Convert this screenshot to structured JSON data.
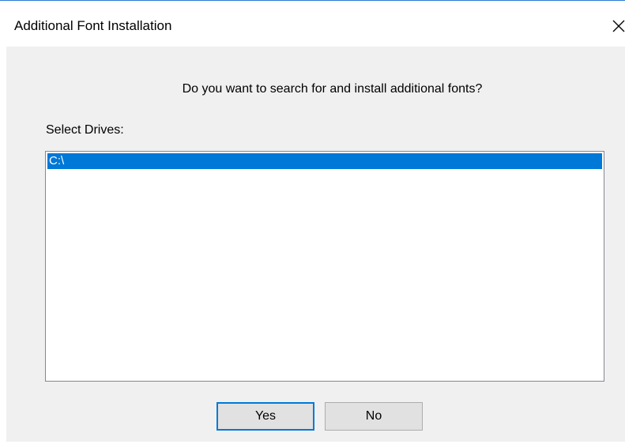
{
  "window": {
    "title": "Additional Font Installation",
    "close_icon": "close-icon"
  },
  "dialog": {
    "question": "Do you want to search for and install additional fonts?",
    "drives_label": "Select Drives:",
    "drives": [
      {
        "label": "C:\\",
        "selected": true
      }
    ],
    "buttons": {
      "yes_label": "Yes",
      "no_label": "No"
    }
  },
  "colors": {
    "selection": "#0078d7",
    "client_background": "#f0f0f0",
    "window_border": "#2a7ad1"
  }
}
